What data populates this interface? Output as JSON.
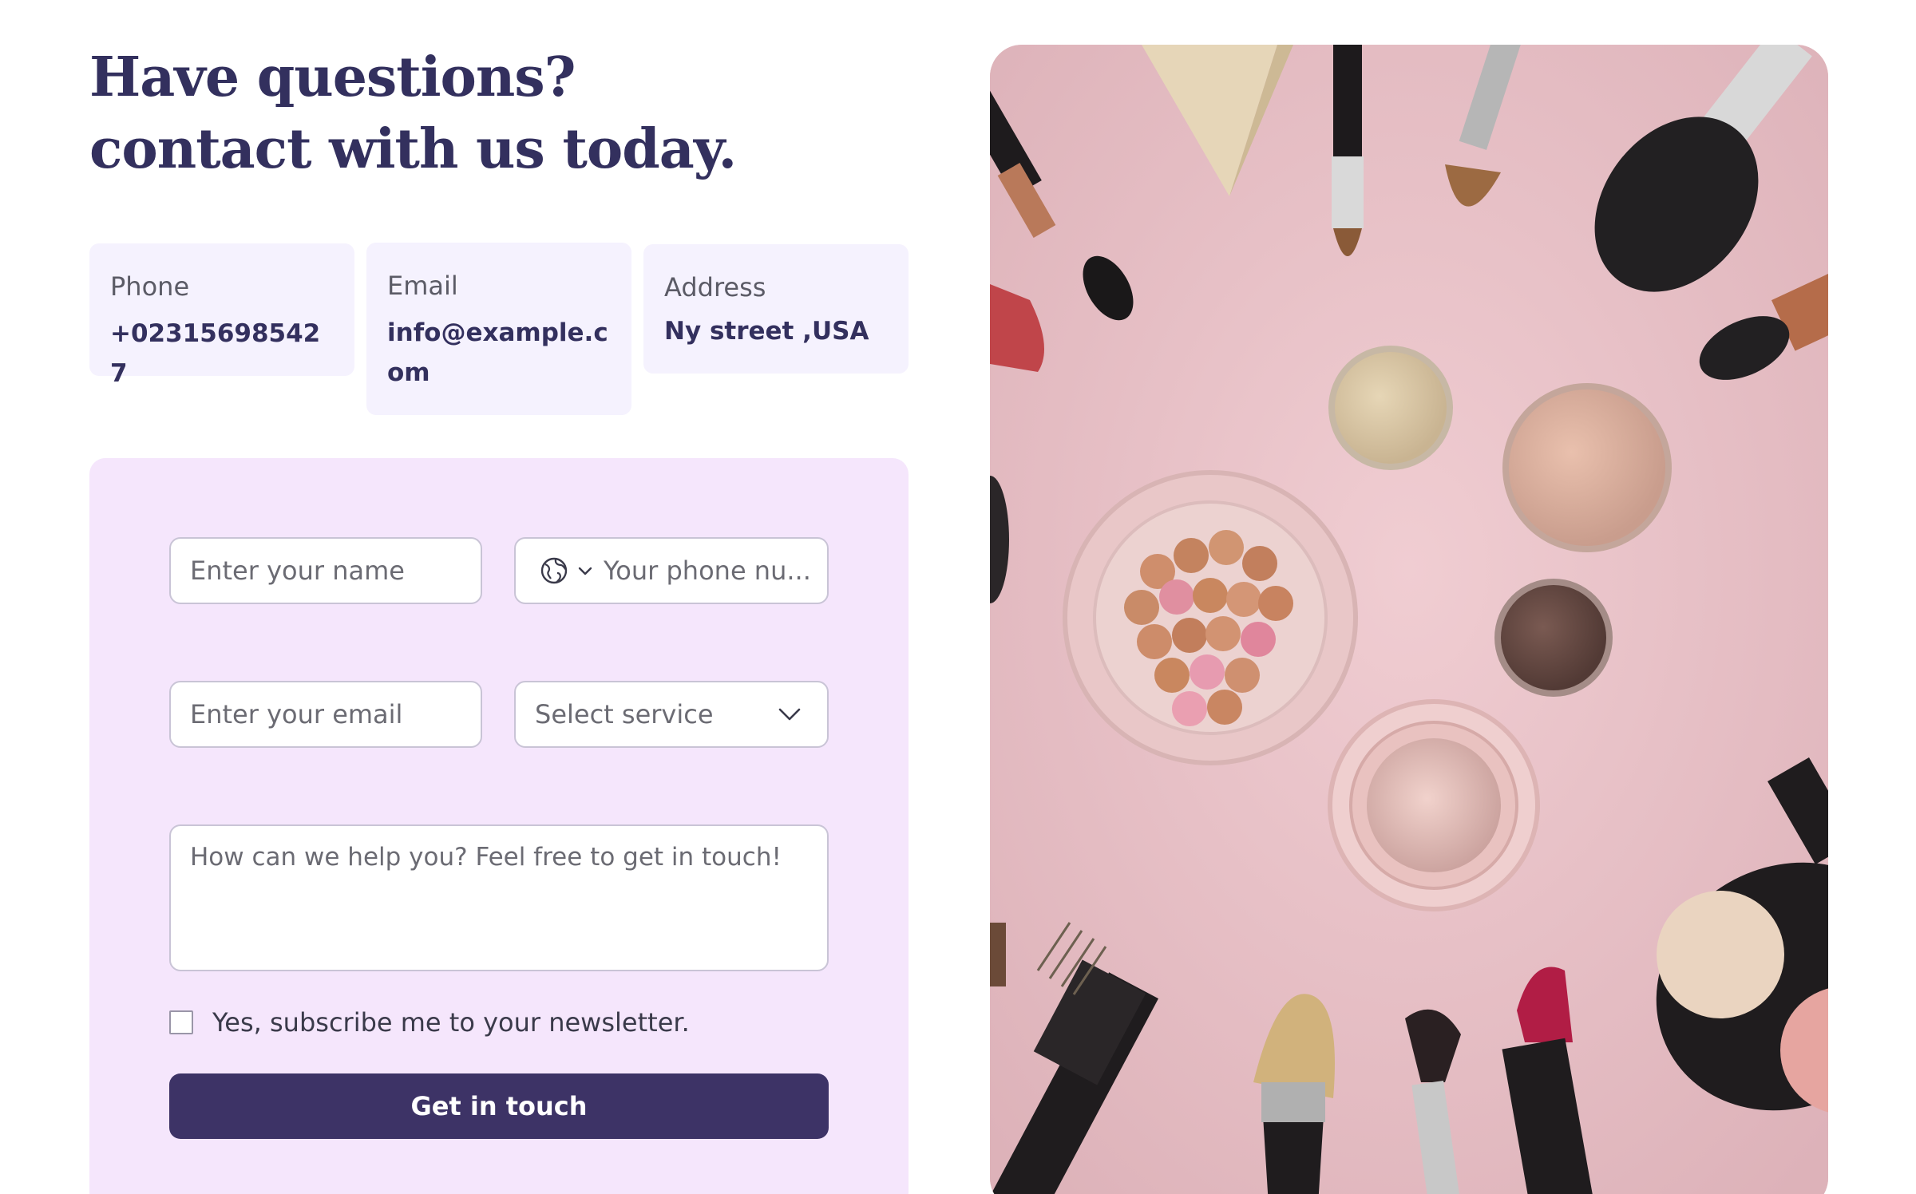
{
  "heading": {
    "line1": "Have questions?",
    "line2": "contact with us today."
  },
  "contact_info": {
    "phone": {
      "label": "Phone",
      "value": "+023156985427"
    },
    "email": {
      "label": "Email",
      "value": "info@example.com"
    },
    "address": {
      "label": "Address",
      "value": "Ny street ,USA"
    }
  },
  "form": {
    "name_placeholder": "Enter your name",
    "phone_placeholder": "Your phone nu...",
    "email_placeholder": "Enter your email",
    "service_placeholder": "Select service",
    "message_placeholder": "How can we help you? Feel free to get in touch!",
    "newsletter_label": "Yes, subscribe me to your newsletter.",
    "newsletter_checked": false,
    "submit_label": "Get in touch"
  },
  "icons": {
    "country": "globe-icon",
    "country_dropdown": "chevron-down-icon",
    "service_dropdown": "chevron-down-icon"
  },
  "colors": {
    "heading": "#33305e",
    "info_card_bg": "#f5f2fe",
    "form_panel_bg": "#f5e6fc",
    "button_bg": "#3d3366",
    "image_bg": "#e8c3c9"
  }
}
